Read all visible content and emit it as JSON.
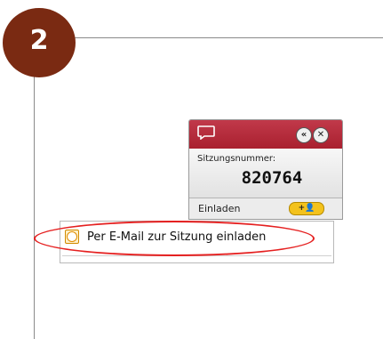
{
  "step": {
    "number": "2",
    "badge_color": "#7a2a12"
  },
  "panel": {
    "header_color": "#b02a3a",
    "icons": [
      "chat-bubble-icon",
      "collapse-icon",
      "close-icon"
    ],
    "collapse_symbol": "«",
    "close_symbol": "✕",
    "session_label": "Sitzungsnummer:",
    "session_number": "820764",
    "invite_label": "Einladen",
    "invite_button_label": "+👤"
  },
  "menu": {
    "item_icon": "clock-icon",
    "item_label": "Per E-Mail zur Sitzung einladen"
  },
  "annotation": {
    "highlight_color": "#e52020"
  }
}
